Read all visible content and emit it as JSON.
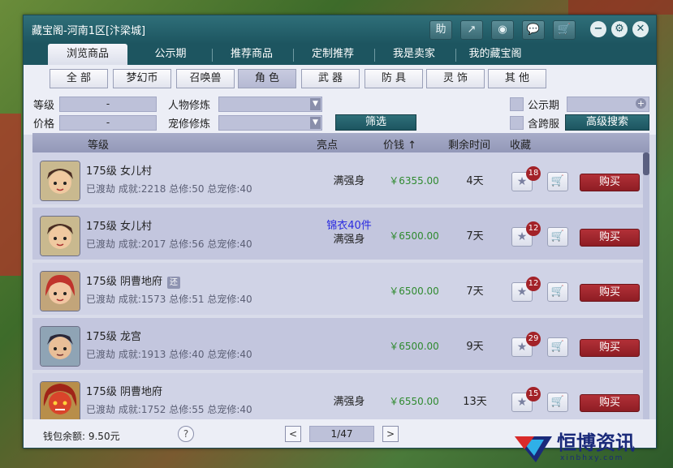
{
  "window": {
    "title": "藏宝阁-河南1区[汴梁城]"
  },
  "toolbar": {
    "help_label": "助",
    "share_icon": "share-icon",
    "stop_icon": "stop-icon",
    "chat_icon": "chat-icon",
    "cart_icon": "cart-icon",
    "minimize_label": "−",
    "settings_label": "⚙",
    "close_label": "✕"
  },
  "tabs": [
    {
      "label": "浏览商品",
      "active": true
    },
    {
      "label": "公示期"
    },
    {
      "label": "推荐商品"
    },
    {
      "label": "定制推荐"
    },
    {
      "label": "我是卖家"
    },
    {
      "label": "我的藏宝阁"
    }
  ],
  "search": {
    "placeholder": ""
  },
  "categories": [
    {
      "label": "全 部"
    },
    {
      "label": "梦幻币"
    },
    {
      "label": "召唤兽"
    },
    {
      "label": "角 色",
      "active": true
    },
    {
      "label": "武 器"
    },
    {
      "label": "防 具"
    },
    {
      "label": "灵 饰"
    },
    {
      "label": "其 他"
    }
  ],
  "filters": {
    "level_label": "等级",
    "level_value": "-",
    "price_label": "价格",
    "price_value": "-",
    "cultivation_label": "人物修炼",
    "pet_cultivation_label": "宠修修炼",
    "filter_button": "筛选",
    "publicity_label": "公示期",
    "cross_server_label": "含跨服",
    "advanced_search": "高级搜索"
  },
  "table": {
    "headers": {
      "level": "等级",
      "highlight": "亮点",
      "price": "价钱",
      "remaining": "剩余时间",
      "favorite": "收藏"
    },
    "buy_label": "购买",
    "rows": [
      {
        "line1": "175级  女儿村",
        "line2": "已渡劫 成就:2218 总修:50 总宠修:40",
        "badge": "",
        "highlight_top": "",
        "highlight": "满强身",
        "price": "￥6355.00",
        "remaining": "4天",
        "favorites": "18",
        "avatar_color": "#7a4a3a"
      },
      {
        "line1": "175级  女儿村",
        "line2": "已渡劫 成就:2017 总修:56 总宠修:40",
        "badge": "",
        "highlight_top": "锦衣40件",
        "highlight": "满强身",
        "price": "￥6500.00",
        "remaining": "7天",
        "favorites": "12",
        "avatar_color": "#7a4a3a"
      },
      {
        "line1": "175级  阴曹地府",
        "line2": "已渡劫 成就:1573 总修:51 总宠修:40",
        "badge": "还",
        "highlight_top": "",
        "highlight": "",
        "price": "￥6500.00",
        "remaining": "7天",
        "favorites": "12",
        "avatar_color": "#b8352f"
      },
      {
        "line1": "175级  龙宫",
        "line2": "已渡劫 成就:1913 总修:40 总宠修:40",
        "badge": "",
        "highlight_top": "",
        "highlight": "",
        "price": "￥6500.00",
        "remaining": "9天",
        "favorites": "29",
        "avatar_color": "#3a3a4a"
      },
      {
        "line1": "175级  阴曹地府",
        "line2": "已渡劫 成就:1752 总修:55 总宠修:40",
        "badge": "",
        "highlight_top": "",
        "highlight": "满强身",
        "price": "￥6550.00",
        "remaining": "13天",
        "favorites": "15",
        "avatar_color": "#c23a1f"
      }
    ]
  },
  "footer": {
    "wallet": "钱包余额:  9.50元",
    "help": "?",
    "prev": "<",
    "page": "1/47",
    "next": ">"
  },
  "watermark": {
    "text": "恒博资讯",
    "sub": "xinbhxy.com"
  }
}
